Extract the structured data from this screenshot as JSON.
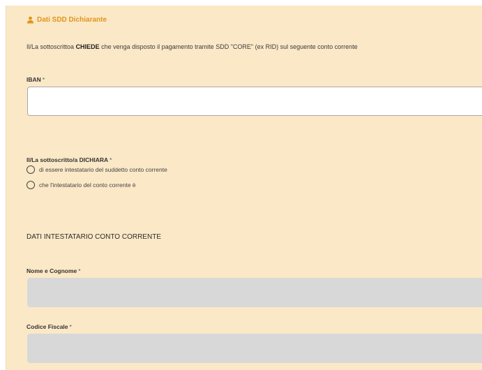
{
  "section": {
    "title": "Dati SDD Dichiarante",
    "icon": "user-icon",
    "accent": "#e0951a"
  },
  "intro": {
    "prefix": "Il/La sottoscrittoa",
    "emphasis": "CHIEDE",
    "suffix": "che venga disposto il pagamento tramite SDD \"CORE\" (ex RID) sul seguente conto corrente"
  },
  "iban": {
    "label": "IBAN",
    "required_mark": "*",
    "value": ""
  },
  "dichiara": {
    "label": "Il/La sottoscritto/a DICHIARA",
    "required_mark": "*",
    "options": [
      "di essere intestatario del suddetto conto corrente",
      "che l'intestatario del conto corrente è"
    ]
  },
  "intestatario": {
    "title": "DATI INTESTATARIO CONTO CORRENTE",
    "nome": {
      "label": "Nome e Cognome",
      "required_mark": "*",
      "value": ""
    },
    "codice_fiscale": {
      "label": "Codice Fiscale",
      "required_mark": "*",
      "value": ""
    }
  },
  "colors": {
    "panel_bg": "#fbe8c6",
    "disabled_field": "#d8d8d8"
  }
}
